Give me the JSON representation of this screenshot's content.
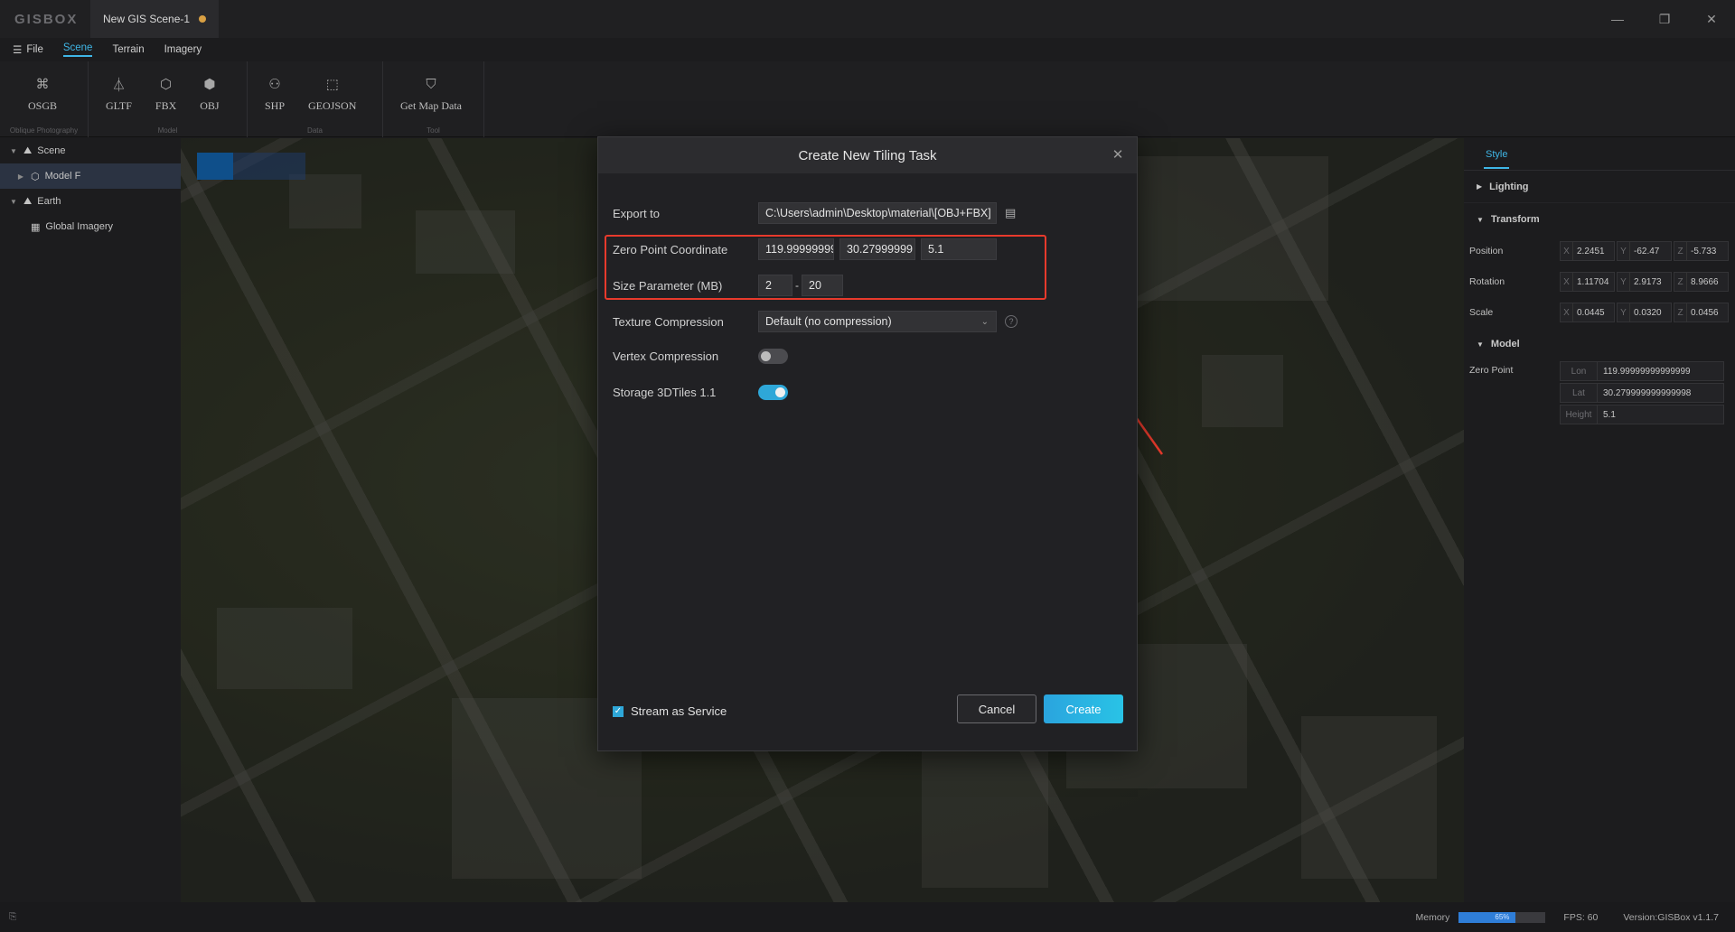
{
  "titlebar": {
    "logo": "GISBOX",
    "doc_tab": "New GIS Scene-1",
    "minimize": "—",
    "restore": "❐",
    "close": "✕"
  },
  "menubar": {
    "file": "File",
    "tabs": [
      "Scene",
      "Terrain",
      "Imagery"
    ],
    "active_tab": "Scene"
  },
  "ribbon": {
    "groups": [
      {
        "name": "Oblique Photography",
        "buttons": [
          {
            "label": "OSGB",
            "icon": "osgb-icon"
          }
        ]
      },
      {
        "name": "Model",
        "buttons": [
          {
            "label": "GLTF",
            "icon": "gltf-icon"
          },
          {
            "label": "FBX",
            "icon": "fbx-icon"
          },
          {
            "label": "OBJ",
            "icon": "obj-icon"
          }
        ]
      },
      {
        "name": "Data",
        "buttons": [
          {
            "label": "SHP",
            "icon": "shp-icon"
          },
          {
            "label": "GEOJSON",
            "icon": "geojson-icon"
          }
        ]
      },
      {
        "name": "Tool",
        "buttons": [
          {
            "label": "Get Map Data",
            "icon": "map-data-icon"
          }
        ]
      }
    ]
  },
  "tree": {
    "scene": "Scene",
    "model": "Model F",
    "earth": "Earth",
    "imagery": "Global Imagery"
  },
  "dialog": {
    "title": "Create New Tiling Task",
    "export_label": "Export to",
    "export_value": "C:\\Users\\admin\\Desktop\\material\\[OBJ+FBX]",
    "zero_label": "Zero Point Coordinate",
    "zero_lon": "119.99999999",
    "zero_lat": "30.27999999",
    "zero_height": "5.1",
    "size_label": "Size Parameter (MB)",
    "size_min": "2",
    "size_max": "20",
    "texture_label": "Texture Compression",
    "texture_value": "Default (no compression)",
    "vertex_label": "Vertex Compression",
    "vertex_on": false,
    "storage_label": "Storage 3DTiles 1.1",
    "storage_on": true,
    "stream_label": "Stream as Service",
    "stream_checked": true,
    "cancel": "Cancel",
    "create": "Create"
  },
  "inspector": {
    "tab": "Style",
    "sections": {
      "lighting": "Lighting",
      "transform": "Transform",
      "model": "Model"
    },
    "position": {
      "label": "Position",
      "x": "2.2451",
      "y": "-62.47",
      "z": "-5.733"
    },
    "rotation": {
      "label": "Rotation",
      "x": "1.11704",
      "y": "2.9173",
      "z": "8.9666"
    },
    "scale": {
      "label": "Scale",
      "x": "0.0445",
      "y": "0.0320",
      "z": "0.0456"
    },
    "zero_point": {
      "label": "Zero Point",
      "lon_key": "Lon",
      "lon": "119.99999999999999",
      "lat_key": "Lat",
      "lat": "30.279999999999998",
      "height_key": "Height",
      "height": "5.1"
    }
  },
  "statusbar": {
    "memory_label": "Memory",
    "memory_percent": 65,
    "memory_text": "65%",
    "fps": "FPS: 60",
    "version": "Version:GISBox v1.1.7"
  },
  "colors": {
    "accent": "#3fb6e6",
    "highlight": "#e83a2c",
    "create_button": "#2aa4de"
  }
}
